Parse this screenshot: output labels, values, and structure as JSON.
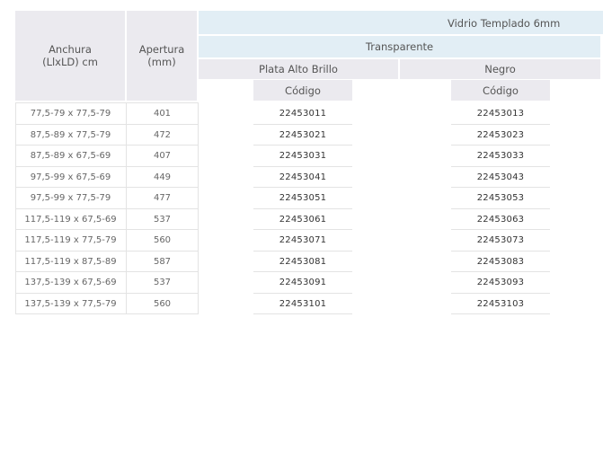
{
  "headers": {
    "width_col": "Anchura\n(LlxLD) cm",
    "aperture_col": "Apertura\n(mm)",
    "glass": "Vidrio Templado 6mm",
    "transparency": "Transparente",
    "finish_1": "Plata Alto Brillo",
    "finish_2": "Negro",
    "code_1": "Código",
    "code_2": "Código"
  },
  "rows": [
    {
      "width": "77,5-79 x 77,5-79",
      "aperture": "401",
      "code_plata": "22453011",
      "code_negro": "22453013"
    },
    {
      "width": "87,5-89 x 77,5-79",
      "aperture": "472",
      "code_plata": "22453021",
      "code_negro": "22453023"
    },
    {
      "width": "87,5-89 x 67,5-69",
      "aperture": "407",
      "code_plata": "22453031",
      "code_negro": "22453033"
    },
    {
      "width": "97,5-99 x 67,5-69",
      "aperture": "449",
      "code_plata": "22453041",
      "code_negro": "22453043"
    },
    {
      "width": "97,5-99 x 77,5-79",
      "aperture": "477",
      "code_plata": "22453051",
      "code_negro": "22453053"
    },
    {
      "width": "117,5-119 x 67,5-69",
      "aperture": "537",
      "code_plata": "22453061",
      "code_negro": "22453063"
    },
    {
      "width": "117,5-119 x 77,5-79",
      "aperture": "560",
      "code_plata": "22453071",
      "code_negro": "22453073"
    },
    {
      "width": "117,5-119 x 87,5-89",
      "aperture": "587",
      "code_plata": "22453081",
      "code_negro": "22453083"
    },
    {
      "width": "137,5-139 x 67,5-69",
      "aperture": "537",
      "code_plata": "22453091",
      "code_negro": "22453093"
    },
    {
      "width": "137,5-139 x 77,5-79",
      "aperture": "560",
      "code_plata": "22453101",
      "code_negro": "22453103"
    }
  ],
  "colors": {
    "header_grey": "#ebeaef",
    "header_blue": "#e2eef5",
    "row_divider": "#e3e3e3"
  }
}
